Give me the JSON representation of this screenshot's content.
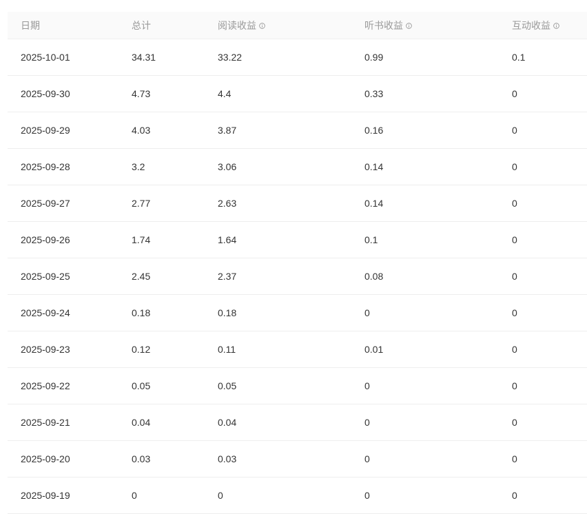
{
  "table": {
    "headers": [
      {
        "label": "日期",
        "info": false
      },
      {
        "label": "总计",
        "info": false
      },
      {
        "label": "阅读收益",
        "info": true
      },
      {
        "label": "听书收益",
        "info": true
      },
      {
        "label": "互动收益",
        "info": true
      }
    ],
    "rows": [
      [
        "2025-10-01",
        "34.31",
        "33.22",
        "0.99",
        "0.1"
      ],
      [
        "2025-09-30",
        "4.73",
        "4.4",
        "0.33",
        "0"
      ],
      [
        "2025-09-29",
        "4.03",
        "3.87",
        "0.16",
        "0"
      ],
      [
        "2025-09-28",
        "3.2",
        "3.06",
        "0.14",
        "0"
      ],
      [
        "2025-09-27",
        "2.77",
        "2.63",
        "0.14",
        "0"
      ],
      [
        "2025-09-26",
        "1.74",
        "1.64",
        "0.1",
        "0"
      ],
      [
        "2025-09-25",
        "2.45",
        "2.37",
        "0.08",
        "0"
      ],
      [
        "2025-09-24",
        "0.18",
        "0.18",
        "0",
        "0"
      ],
      [
        "2025-09-23",
        "0.12",
        "0.11",
        "0.01",
        "0"
      ],
      [
        "2025-09-22",
        "0.05",
        "0.05",
        "0",
        "0"
      ],
      [
        "2025-09-21",
        "0.04",
        "0.04",
        "0",
        "0"
      ],
      [
        "2025-09-20",
        "0.03",
        "0.03",
        "0",
        "0"
      ],
      [
        "2025-09-19",
        "0",
        "0",
        "0",
        "0"
      ]
    ]
  },
  "colors": {
    "header_text": "#999999",
    "body_text": "#333333",
    "header_bg": "#fafafa",
    "divider": "#eeeeee"
  },
  "icons": {
    "column_info": "info-circle-icon"
  }
}
